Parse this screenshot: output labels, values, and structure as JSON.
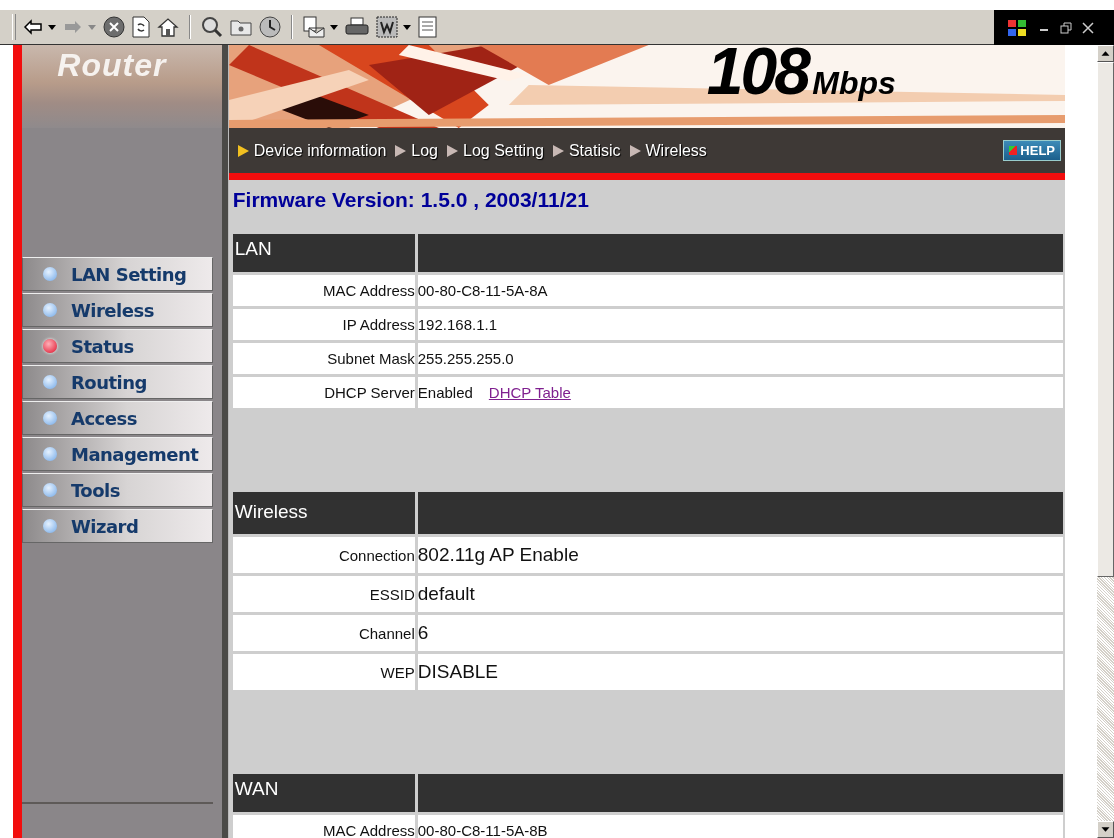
{
  "sidebar": {
    "brand": "Router",
    "items": [
      {
        "label": "LAN Setting",
        "selected": false
      },
      {
        "label": "Wireless",
        "selected": false
      },
      {
        "label": "Status",
        "selected": true
      },
      {
        "label": "Routing",
        "selected": false
      },
      {
        "label": "Access",
        "selected": false
      },
      {
        "label": "Management",
        "selected": false
      },
      {
        "label": "Tools",
        "selected": false
      },
      {
        "label": "Wizard",
        "selected": false
      }
    ]
  },
  "banner": {
    "speed": "108",
    "unit": "Mbps"
  },
  "nav": {
    "items": [
      {
        "label": "Device information",
        "selected": true
      },
      {
        "label": "Log",
        "selected": false
      },
      {
        "label": "Log Setting",
        "selected": false
      },
      {
        "label": "Statisic",
        "selected": false
      },
      {
        "label": "Wireless",
        "selected": false
      }
    ],
    "help": "HELP"
  },
  "firmware": "Firmware Version: 1.5.0 , 2003/11/21",
  "sections": [
    {
      "title": "LAN",
      "kind": "compact",
      "rows": [
        {
          "label": "MAC Address",
          "value": "00-80-C8-11-5A-8A"
        },
        {
          "label": "IP Address",
          "value": "192.168.1.1"
        },
        {
          "label": "Subnet Mask",
          "value": "255.255.255.0"
        },
        {
          "label": "DHCP Server",
          "value": "Enabled",
          "link": "DHCP Table"
        }
      ]
    },
    {
      "title": "Wireless",
      "kind": "large",
      "rows": [
        {
          "label": "Connection",
          "value": "802.11g AP Enable"
        },
        {
          "label": "ESSID",
          "value": "default"
        },
        {
          "label": "Channel",
          "value": "6"
        },
        {
          "label": "WEP",
          "value": "DISABLE"
        }
      ]
    },
    {
      "title": "WAN",
      "kind": "compact",
      "rows": [
        {
          "label": "MAC Address",
          "value": "00-80-C8-11-5A-8B"
        }
      ]
    }
  ]
}
